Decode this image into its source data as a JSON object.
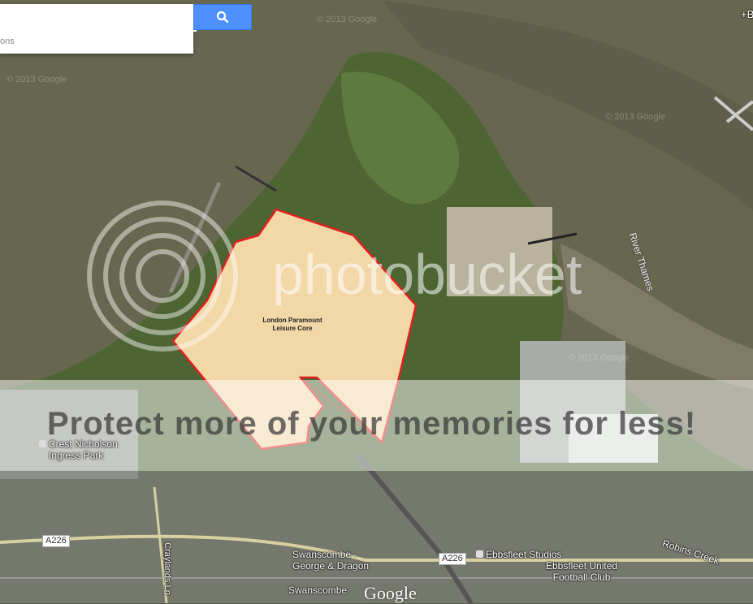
{
  "search": {
    "placeholder": "",
    "sub_text": "ons",
    "button_icon": "search-icon"
  },
  "colors": {
    "water": "#6b6a55",
    "land": "#4f6a35",
    "urban": "#8a8f86",
    "polygon_fill": "#ffe0b0",
    "polygon_stroke": "#e02020",
    "search_button": "#4d90fe"
  },
  "polygon": {
    "label_line1": "London Paramount",
    "label_line2": "Leisure Core"
  },
  "labels": {
    "river_thames": "River Thames",
    "crest_nicholson": "Crest Nicholson",
    "ingress_park": "Ingress Park",
    "a226_left": "A226",
    "a226_right": "A226",
    "craylands": "Craylands Ln",
    "swanscombe_gd_1": "Swanscombe -",
    "swanscombe_gd_2": "George & Dragon",
    "ebbsfleet_studios": "Ebbsfleet Studios",
    "ebbsfleet_united_1": "Ebbsfleet United",
    "ebbsfleet_united_2": "Football Club",
    "swanscombe": "Swanscombe",
    "robins_creek": "Robins Creek",
    "corner_mark": "+B",
    "google": "Google",
    "copyright": "© 2013 Google"
  },
  "watermark": {
    "brand": "photobucket",
    "banner": "Protect more of your memories for less!"
  }
}
